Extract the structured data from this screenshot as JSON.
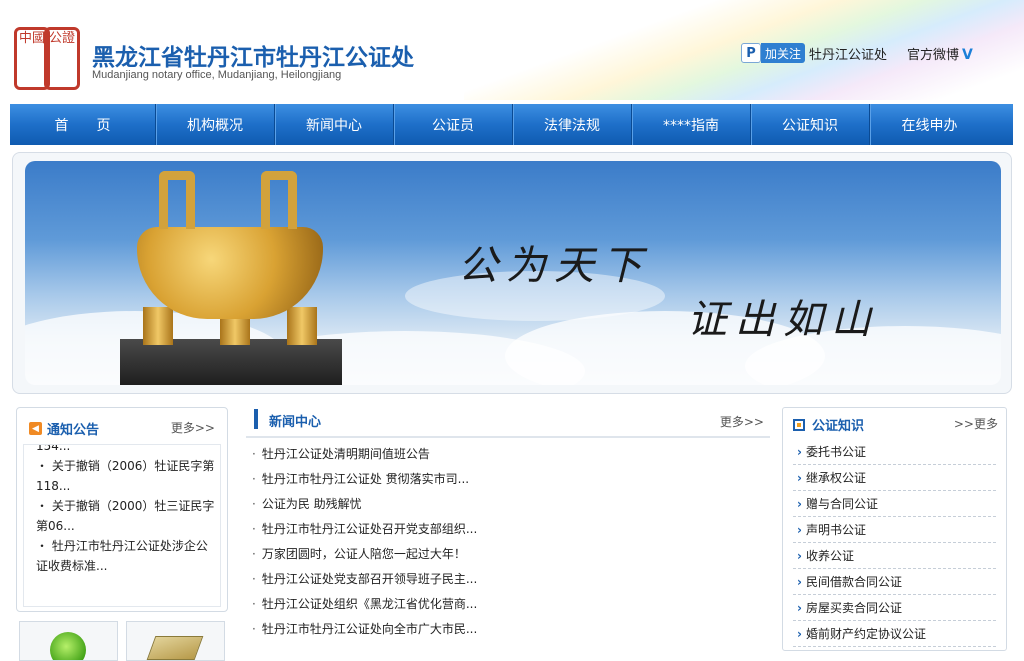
{
  "header": {
    "seal_chars_1": "中國",
    "seal_chars_2": "公證",
    "title": "黑龙江省牡丹江市牡丹江公证处",
    "subtitle": "Mudanjiang notary office, Mudanjiang, Heilongjiang",
    "follow_label": "加关注",
    "follow_name": "牡丹江公证处",
    "weibo_label": "官方微博"
  },
  "nav": {
    "items": [
      "首　　页",
      "机构概况",
      "新闻中心",
      "公证员",
      "法律法规",
      "****指南",
      "公证知识",
      "在线申办"
    ]
  },
  "banner": {
    "line1": "公为天下",
    "line2": "证出如山"
  },
  "notice": {
    "title": "通知公告",
    "more": "更多>>",
    "items": [
      "154...",
      "・ 关于撤销（2006）牡证民字第118...",
      "・ 关于撤销（2000）牡三证民字第06...",
      "・ 牡丹江市牡丹江公证处涉企公证收费标准..."
    ]
  },
  "news": {
    "title": "新闻中心",
    "more": "更多>>",
    "items": [
      "牡丹江公证处清明期间值班公告",
      "牡丹江市牡丹江公证处 贯彻落实市司...",
      "公证为民 助残解忧",
      "牡丹江市牡丹江公证处召开党支部组织...",
      "万家团圆时，公证人陪您一起过大年！",
      "牡丹江公证处党支部召开领导班子民主...",
      "牡丹江公证处组织《黑龙江省优化营商...",
      "牡丹江市牡丹江公证处向全市广大市民..."
    ]
  },
  "knowledge": {
    "title": "公证知识",
    "more": ">>更多",
    "items": [
      "委托书公证",
      "继承权公证",
      "赠与合同公证",
      "声明书公证",
      "收养公证",
      "民间借款合同公证",
      "房屋买卖合同公证",
      "婚前财产约定协议公证"
    ]
  }
}
